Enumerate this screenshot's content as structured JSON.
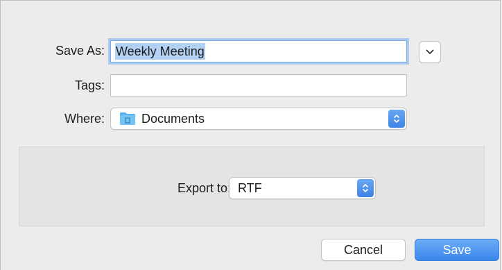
{
  "dialog": {
    "save_as": {
      "label": "Save As:",
      "value": "Weekly Meeting"
    },
    "tags": {
      "label": "Tags:",
      "value": ""
    },
    "where": {
      "label": "Where:",
      "value": "Documents",
      "icon": "folder-icon"
    },
    "disclosure_icon": "chevron-down-icon",
    "export": {
      "label": "Export to:",
      "value": "RTF"
    },
    "buttons": {
      "cancel": "Cancel",
      "save": "Save"
    }
  },
  "colors": {
    "accent": "#3d82e6",
    "selection": "#b2d1f3",
    "focus_ring": "#a9c9ef",
    "folder": "#5db4ec"
  }
}
